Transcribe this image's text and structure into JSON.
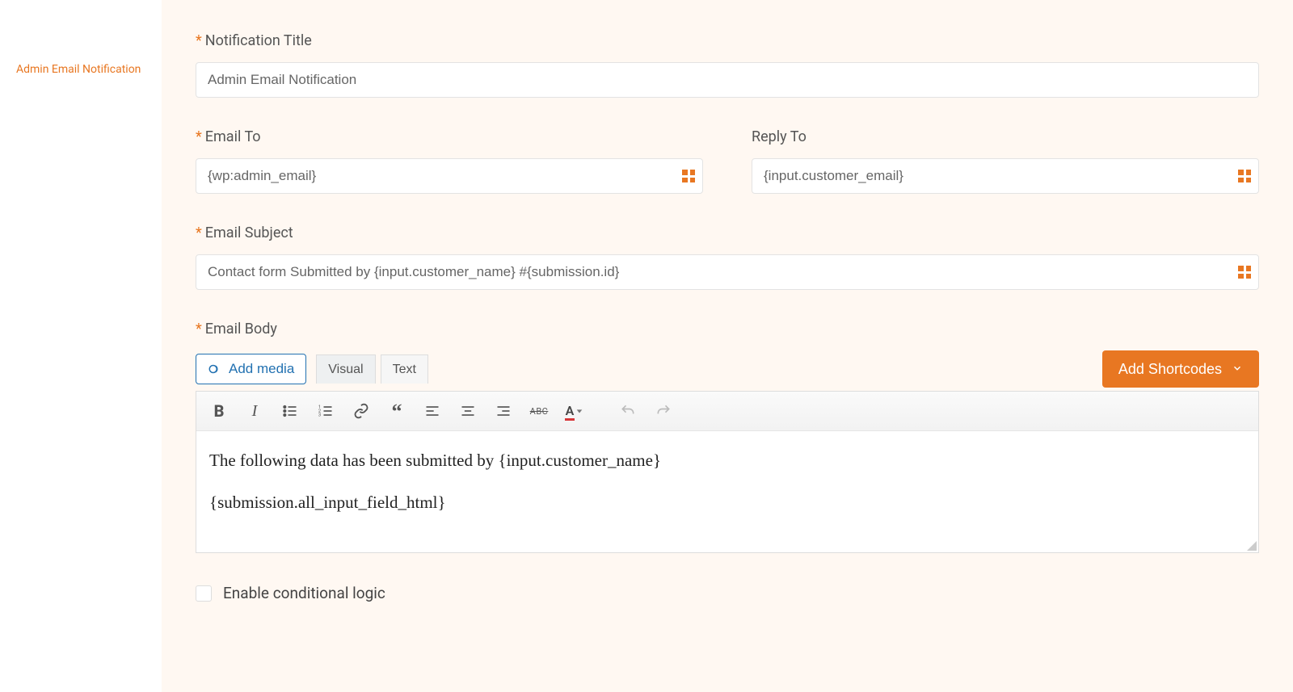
{
  "sidebar": {
    "active_item": "Admin Email Notification"
  },
  "form": {
    "notification_title_label": "Notification Title",
    "notification_title_value": "Admin Email Notification",
    "email_to_label": "Email To",
    "email_to_value": "{wp:admin_email}",
    "reply_to_label": "Reply To",
    "reply_to_value": "{input.customer_email}",
    "email_subject_label": "Email Subject",
    "email_subject_value": "Contact form Submitted by {input.customer_name} #{submission.id}",
    "email_body_label": "Email Body",
    "add_media_label": "Add media",
    "tab_visual": "Visual",
    "tab_text": "Text",
    "add_shortcodes_label": "Add Shortcodes",
    "body_line1": "The following data has been submitted by {input.customer_name}",
    "body_line2": "{submission.all_input_field_html}",
    "conditional_logic_label": "Enable conditional logic"
  },
  "format_bar": {
    "bold": "B",
    "strike": "ABC"
  }
}
